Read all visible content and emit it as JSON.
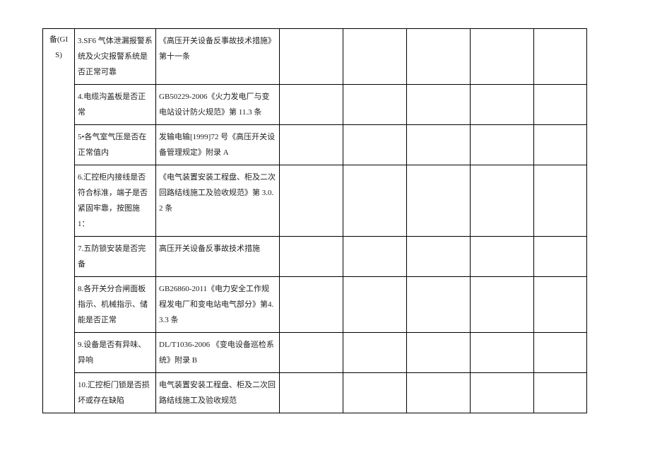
{
  "rows": [
    {
      "a": "备(GIS)",
      "b": "3.SF6 气体泄漏报警系统及火灾报警系统是否正常可靠",
      "c": "《高压开关设备反事故技术措施》第十一条"
    },
    {
      "b": "4.电缆沟盖板是否正常",
      "c": "GB50229-2006《火力发电厂与变电站设计防火规范》第 11.3 条"
    },
    {
      "b": "5•各气室气压是否在正常值内",
      "c": "发输电输[1999]72 号《高压开关设备管理规定》附录 A"
    },
    {
      "b": "6.汇控柜内接线是否符合标准，端子是否紧固牢靠，按图施 1：",
      "c": "《电气装置安装工程盘、柜及二次回路结线施工及验收规范》第 3.0.2 条"
    },
    {
      "b": "7.五防锁安装是否完备",
      "c": "高压开关设备反事故技术措施"
    },
    {
      "b": "8.各开关分合闸面板指示、机械指示、储能是否正常",
      "c": "GB26860-2011《电力安全工作规程发电厂和变电站电气部分》第4.3.3 条"
    },
    {
      "b": "9.设备是否有异味、异响",
      "c": "DL/T1036-2006 《变电设备巡检系统》附录 B"
    },
    {
      "b": "10.汇控柜门锁是否损坏或存在缺陷",
      "c": "电气装置安装工程盘、柜及二次回路结线施工及验收规范"
    }
  ]
}
